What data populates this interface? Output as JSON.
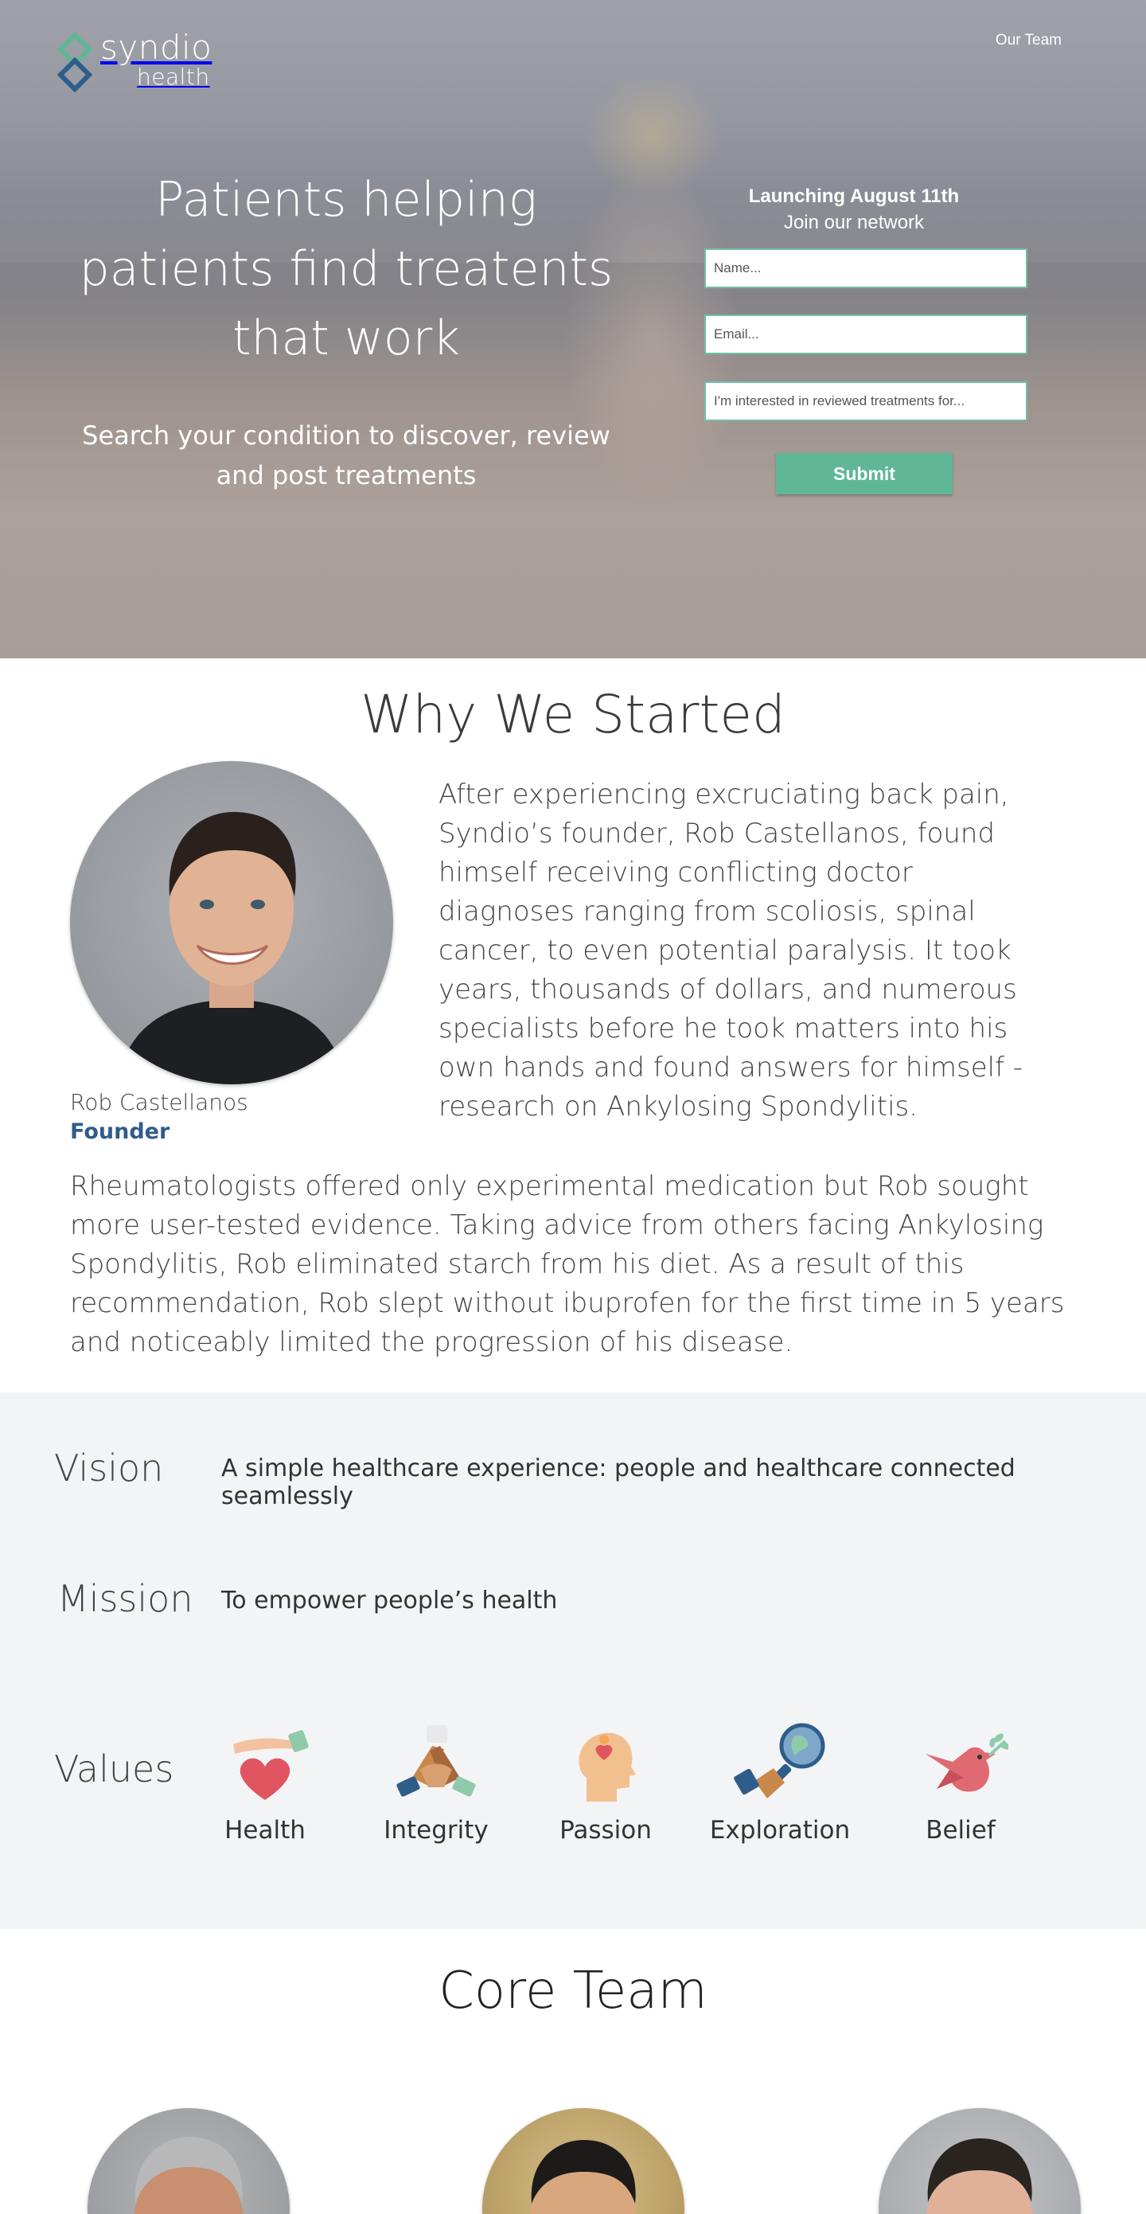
{
  "brand": {
    "name_line1": "syndio",
    "name_line2": "health",
    "accent_color": "#5fb797",
    "link_color": "#2f5d8a"
  },
  "nav": {
    "our_team": "Our Team"
  },
  "hero": {
    "headline": "Patients helping patients find treatents that work",
    "subheadline": "Search your condition to discover, review and post treatments"
  },
  "signup": {
    "title": "Launching August 11th",
    "subtitle": "Join our network",
    "name_placeholder": "Name...",
    "email_placeholder": "Email...",
    "interest_placeholder": "I'm interested in reviewed treatments for...",
    "submit_label": "Submit"
  },
  "why": {
    "title": "Why We Started",
    "founder_name": "Rob Castellanos",
    "founder_role": "Founder",
    "paragraph1": "After experiencing excruciating back pain, Syndio’s founder, Rob Castellanos, found himself receiving conflicting doctor diagnoses ranging from scoliosis, spinal cancer, to even potential paralysis. It took years, thousands of dollars, and numerous specialists before he took matters into his own hands and found answers for himself - research on Ankylosing Spondylitis.",
    "paragraph2": "Rheumatologists offered only experimental medication but Rob sought more user-tested evidence. Taking advice from others facing Ankylosing Spondylitis, Rob eliminated starch from his diet. As a result of this recommendation, Rob slept without ibuprofen for the first time in 5 years and noticeably limited the progression of his disease."
  },
  "vision": {
    "label": "Vision",
    "text": "A simple healthcare experience: people and healthcare connected seamlessly"
  },
  "mission": {
    "label": "Mission",
    "text": "To empower people’s health"
  },
  "values": {
    "label": "Values",
    "items": [
      {
        "label": "Health",
        "icon": "heart-hand-icon"
      },
      {
        "label": "Integrity",
        "icon": "hands-together-icon"
      },
      {
        "label": "Passion",
        "icon": "head-heart-icon"
      },
      {
        "label": "Exploration",
        "icon": "magnifier-globe-icon"
      },
      {
        "label": "Belief",
        "icon": "dove-icon"
      }
    ]
  },
  "team": {
    "title": "Core Team"
  }
}
